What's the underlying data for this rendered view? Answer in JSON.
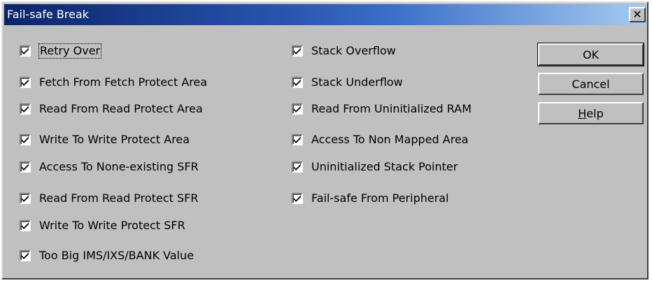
{
  "window": {
    "title": "Fail-safe Break",
    "close_label": "✕"
  },
  "left_options": [
    {
      "label": "Retry Over",
      "checked": true
    },
    {
      "label": "Fetch From Fetch Protect Area",
      "checked": true
    },
    {
      "label": "Read From Read Protect Area",
      "checked": true
    },
    {
      "label": "Write To Write Protect Area",
      "checked": true
    },
    {
      "label": "Access To None-existing SFR",
      "checked": true
    },
    {
      "label": "Read From Read Protect SFR",
      "checked": true
    },
    {
      "label": "Write To Write Protect SFR",
      "checked": true
    },
    {
      "label": "Too Big IMS/IXS/BANK Value",
      "checked": true
    }
  ],
  "right_options": [
    {
      "label": "Stack Overflow",
      "checked": true
    },
    {
      "label": "Stack Underflow",
      "checked": true
    },
    {
      "label": "Read From Uninitialized RAM",
      "checked": true
    },
    {
      "label": "Access To Non Mapped Area",
      "checked": true
    },
    {
      "label": "Uninitialized Stack Pointer",
      "checked": true
    },
    {
      "label": "Fail-safe From Peripheral",
      "checked": true
    }
  ],
  "buttons": {
    "ok_label": "OK",
    "cancel_label": "Cancel",
    "help_mnemonic": "H",
    "help_rest": "elp"
  }
}
